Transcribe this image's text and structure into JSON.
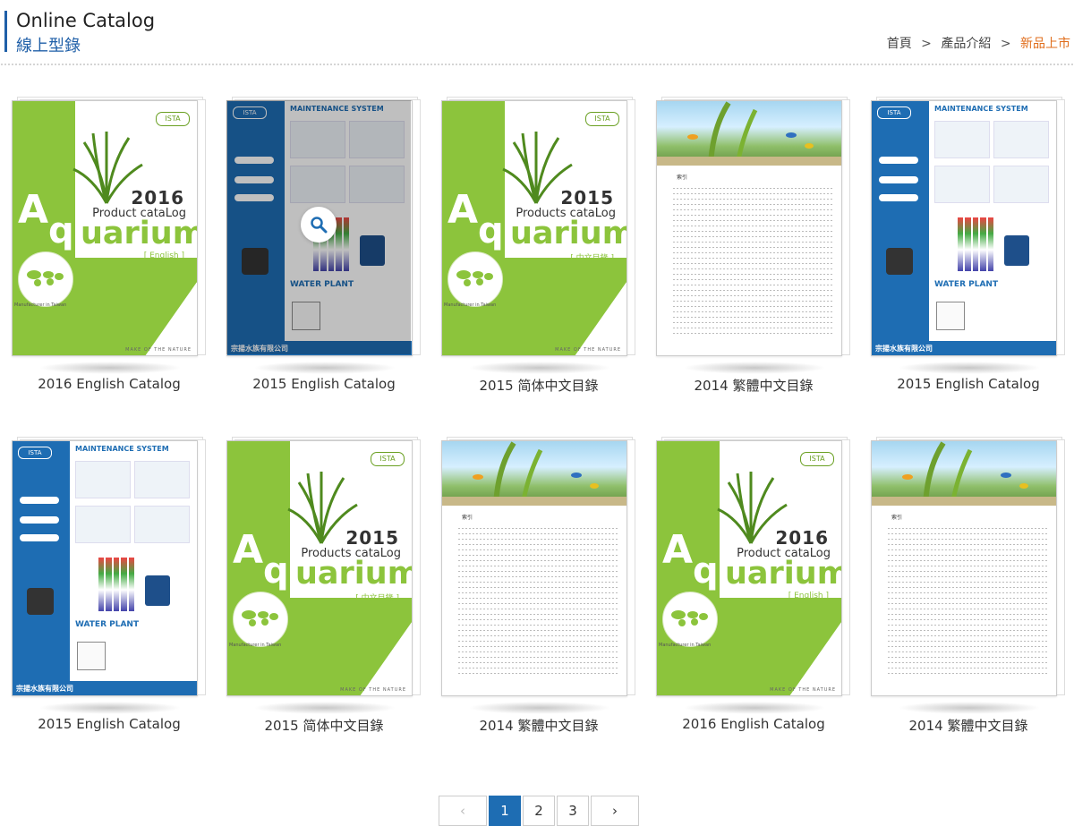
{
  "header": {
    "title_en": "Online Catalog",
    "title_zh": "線上型錄",
    "breadcrumb": [
      {
        "label": "首頁"
      },
      {
        "label": "產品介紹"
      },
      {
        "label": "新品上市"
      }
    ]
  },
  "catalogs": [
    {
      "caption": "2016 English Catalog",
      "cover": "aquarium",
      "year": "2016",
      "product_text": "Product cataLog",
      "lang": "[ English ]"
    },
    {
      "caption": "2015 English Catalog",
      "cover": "maintenance"
    },
    {
      "caption": "2015 简体中文目錄",
      "cover": "aquarium",
      "year": "2015",
      "product_text": "Products cataLog",
      "lang": "[ 中文目錄 ]"
    },
    {
      "caption": "2014 繁體中文目錄",
      "cover": "index"
    },
    {
      "caption": "2015 English Catalog",
      "cover": "maintenance"
    },
    {
      "caption": "2015 English Catalog",
      "cover": "maintenance"
    },
    {
      "caption": "2015 简体中文目錄",
      "cover": "aquarium",
      "year": "2015",
      "product_text": "Products cataLog",
      "lang": "[ 中文目錄 ]"
    },
    {
      "caption": "2014 繁體中文目錄",
      "cover": "index"
    },
    {
      "caption": "2016 English Catalog",
      "cover": "aquarium",
      "year": "2016",
      "product_text": "Product cataLog",
      "lang": "[ English ]"
    },
    {
      "caption": "2014 繁體中文目錄",
      "cover": "index"
    }
  ],
  "cover_text": {
    "aquarium_A": "A",
    "aquarium_q": "q",
    "aquarium_word": "uarium",
    "made_in": "Manufacturer in Taiwan",
    "nature": "MAKE OF THE NATURE",
    "maintenance_title": "MAINTENANCE SYSTEM",
    "water_plant": "WATER PLANT",
    "company": "宗揚水族有限公司",
    "index_title": "索引"
  },
  "pagination": {
    "prev_icon": "chevron-left-icon",
    "next_icon": "chevron-right-icon",
    "pages": [
      "1",
      "2",
      "3"
    ],
    "active_page": "1"
  },
  "colors": {
    "accent_blue": "#1e6db3",
    "breadcrumb_current": "#e06d1b",
    "catalog_green": "#8cc43c"
  }
}
